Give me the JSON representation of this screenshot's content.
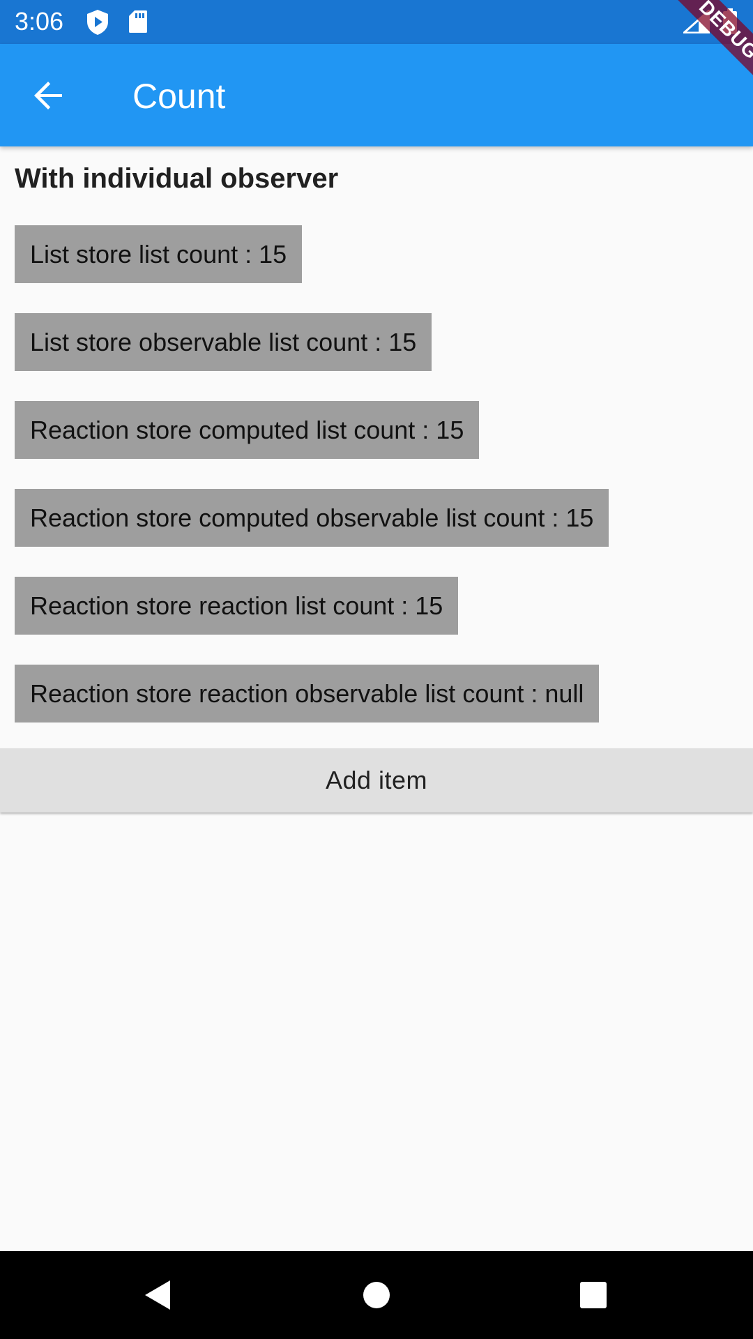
{
  "status_bar": {
    "time": "3:06",
    "icons": [
      "play-protect-icon",
      "sd-card-icon",
      "signal-icon",
      "battery-icon"
    ]
  },
  "app_bar": {
    "title": "Count",
    "back_icon": "arrow-back-icon",
    "background": "#2196f3"
  },
  "debug_banner": {
    "label": "DEBUG"
  },
  "content": {
    "heading": "With individual observer",
    "items": [
      {
        "label": "List store list count : 15"
      },
      {
        "label": "List store observable list count : 15"
      },
      {
        "label": "Reaction store computed list count : 15"
      },
      {
        "label": "Reaction store computed observable list count : 15"
      },
      {
        "label": "Reaction store reaction list count : 15"
      },
      {
        "label": "Reaction store reaction observable list count : null"
      }
    ],
    "add_button_label": "Add item"
  },
  "nav_bar": {
    "buttons": [
      "back-triangle-icon",
      "home-circle-icon",
      "recents-square-icon"
    ]
  }
}
